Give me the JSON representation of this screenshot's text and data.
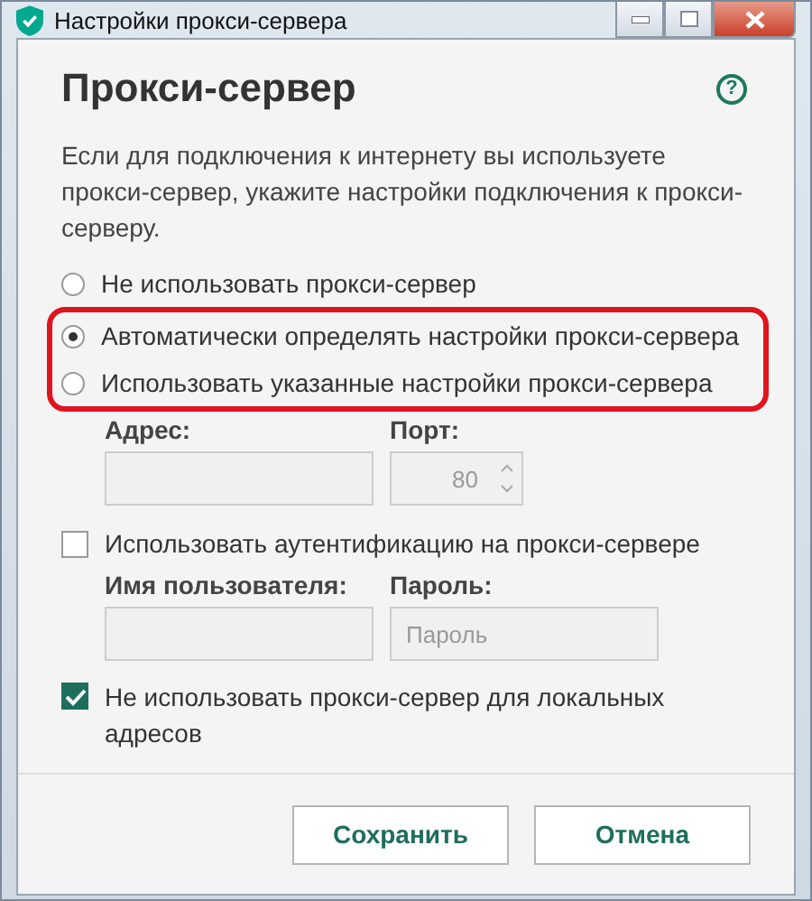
{
  "window": {
    "title": "Настройки прокси-сервера"
  },
  "heading": "Прокси-сервер",
  "help": "?",
  "description": "Если для подключения к интернету вы используете прокси-сервер, укажите настройки подключения к прокси-серверу.",
  "proxy_modes": [
    {
      "label": "Не использовать прокси-сервер",
      "selected": false,
      "highlighted": false
    },
    {
      "label": "Автоматически определять настройки прокси-сервера",
      "selected": true,
      "highlighted": true
    },
    {
      "label": "Использовать указанные настройки прокси-сервера",
      "selected": false,
      "highlighted": true
    }
  ],
  "address": {
    "label": "Адрес:",
    "disabled": true
  },
  "port": {
    "label": "Порт:",
    "value": "80",
    "disabled": true
  },
  "auth": {
    "label": "Использовать аутентификацию на прокси-сервере",
    "checked": false
  },
  "username": {
    "label": "Имя пользователя:",
    "disabled": true
  },
  "password": {
    "label": "Пароль:",
    "placeholder": "Пароль",
    "disabled": true
  },
  "bypass_local": {
    "label": "Не использовать прокси-сервер для локальных адресов",
    "checked": true
  },
  "buttons": [
    "Сохранить",
    "Отмена"
  ]
}
